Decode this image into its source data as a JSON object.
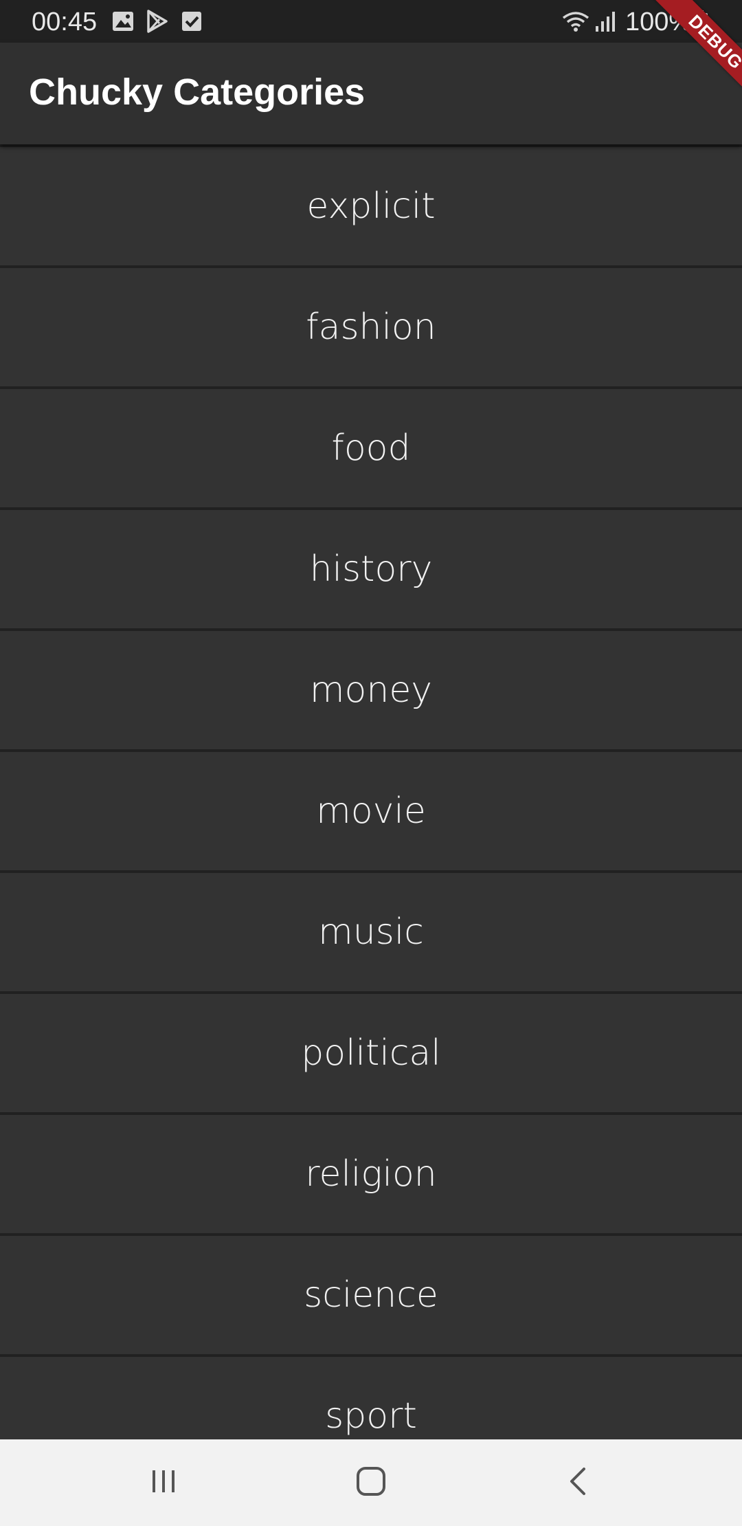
{
  "status_bar": {
    "time": "00:45",
    "battery": "100%",
    "icons": [
      "image-icon",
      "play-store-icon",
      "checkbox-icon",
      "wifi-icon",
      "signal-icon",
      "battery-icon"
    ]
  },
  "app_bar": {
    "title": "Chucky Categories"
  },
  "debug_banner": {
    "label": "DEBUG",
    "color": "#a51d22"
  },
  "categories": [
    "explicit",
    "fashion",
    "food",
    "history",
    "money",
    "movie",
    "music",
    "political",
    "religion",
    "science",
    "sport"
  ],
  "nav_bar": {
    "buttons": [
      "recent-apps-icon",
      "home-icon",
      "back-icon"
    ]
  },
  "colors": {
    "background": "#212121",
    "card": "#333333",
    "app_bar": "#303030",
    "text": "#f2f2f2",
    "nav_bar": "#f2f2f2"
  }
}
